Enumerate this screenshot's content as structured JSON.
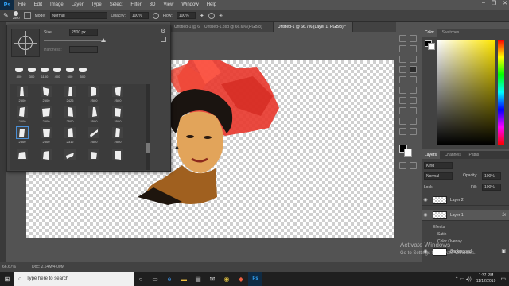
{
  "menu": {
    "logo": "Ps",
    "items": [
      "File",
      "Edit",
      "Image",
      "Layer",
      "Type",
      "Select",
      "Filter",
      "3D",
      "View",
      "Window",
      "Help"
    ]
  },
  "options_bar": {
    "brush_size": "2500",
    "mode_label": "Mode:",
    "mode_value": "Normal",
    "opacity_label": "Opacity:",
    "opacity_value": "100%",
    "flow_label": "Flow:",
    "flow_value": "100%"
  },
  "tabs": [
    "Untitled-1 @ 66.7% (Layer 1, RGB/8)",
    "Untitled-1.psd @ 66.6% (RGB/8)",
    "Untitled-1 @ 66.7% (Layer 1, RGB/8) *"
  ],
  "brush_panel": {
    "size_label": "Size:",
    "size_value": "2500 px",
    "hardness_label": "Hardness:",
    "top_row_sizes": [
      "800",
      "300",
      "1100",
      "400",
      "600",
      "500"
    ],
    "grid_sizes": [
      [
        "2500",
        "2500",
        "2426",
        "2500",
        "2500"
      ],
      [
        "2500",
        "2500",
        "2500",
        "2500",
        "2500"
      ],
      [
        "2500",
        "2500",
        "2312",
        "2500",
        "2500"
      ],
      [
        "",
        "",
        "",
        "",
        ""
      ]
    ]
  },
  "color_panel": {
    "tabs": [
      "Color",
      "Swatches"
    ],
    "hue_accent": "#ffe600"
  },
  "layers_panel": {
    "tabs": [
      "Layers",
      "Channels",
      "Paths"
    ],
    "kind_label": "Kind",
    "blend_mode": "Normal",
    "opacity_label": "Opacity:",
    "opacity_value": "100%",
    "lock_label": "Lock:",
    "fill_label": "Fill:",
    "fill_value": "100%",
    "layers": [
      "Layer 2",
      "Layer 1"
    ],
    "effects": [
      "Effects",
      "Satin",
      "Color Overlay"
    ],
    "background": "Background"
  },
  "watermark": {
    "line1": "Activate Windows",
    "line2": "Go to Settings to activate Windows."
  },
  "status_bar": {
    "zoom": "66.67%",
    "doc": "Doc: 2.64M/4.00M"
  },
  "taskbar": {
    "search_placeholder": "Type here to search",
    "time": "1:37 PM",
    "date": "11/12/2019"
  }
}
